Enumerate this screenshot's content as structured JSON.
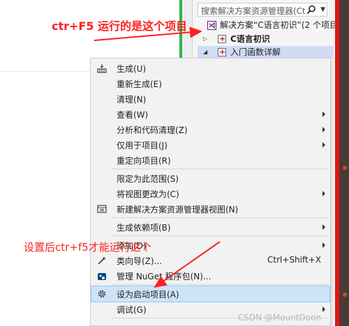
{
  "solution_explorer": {
    "search_placeholder": "搜索解决方案资源管理器(Ctrl",
    "solution_label": "解决方案“C语言初识”(2 个项目",
    "project1": "C语言初识",
    "project2": "入门函数详解"
  },
  "menu": {
    "items": [
      {
        "label": "生成(U)"
      },
      {
        "label": "重新生成(E)"
      },
      {
        "label": "清理(N)"
      },
      {
        "label": "查看(W)"
      },
      {
        "label": "分析和代码清理(Z)"
      },
      {
        "label": "仅用于项目(J)"
      },
      {
        "label": "重定向项目(R)"
      },
      {
        "label": "限定为此范围(S)"
      },
      {
        "label": "将视图更改为(C)"
      },
      {
        "label": "新建解决方案资源管理器视图(N)"
      },
      {
        "label": "生成依赖项(B)"
      },
      {
        "label": "添加(D)"
      },
      {
        "label": "类向导(Z)...",
        "shortcut": "Ctrl+Shift+X"
      },
      {
        "label": "管理 NuGet 程序包(N)..."
      },
      {
        "label": "设为启动项目(A)"
      },
      {
        "label": "调试(G)"
      }
    ]
  },
  "annotations": {
    "top": "ctr+F5 运行的是这个项目",
    "bottom": "设置后ctr+f5才能运行这个"
  },
  "watermark": "CSDN @MountDoon",
  "colors": {
    "annotation": "#ff1f1f",
    "highlight": "#cce4f7",
    "menu_bg": "#f2f2f2"
  }
}
